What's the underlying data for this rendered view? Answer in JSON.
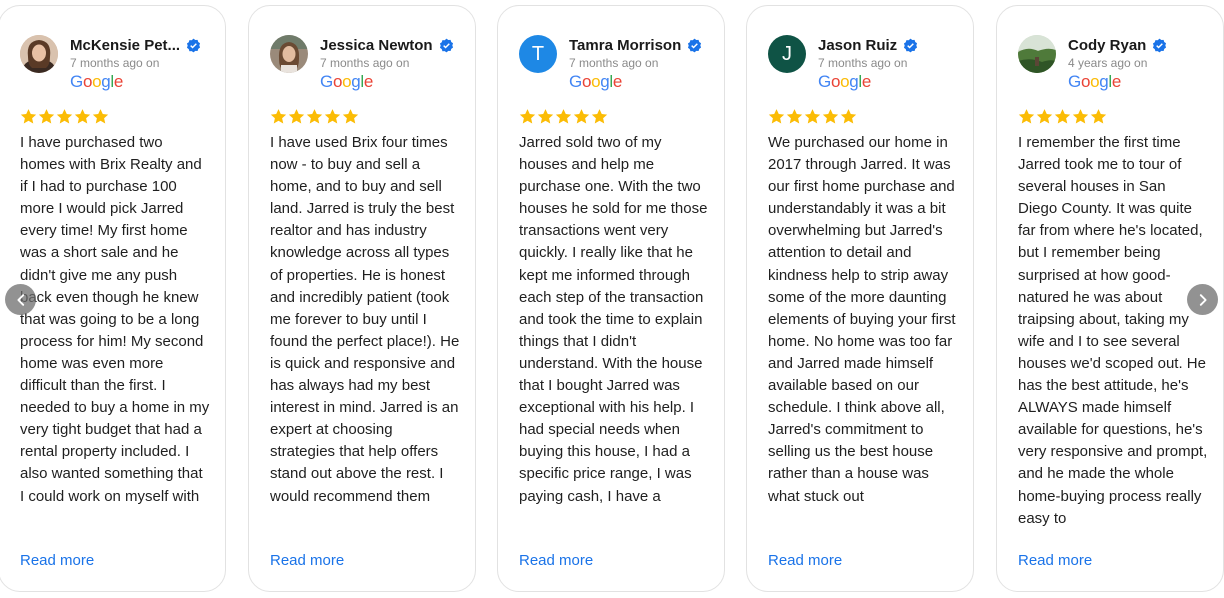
{
  "google_label": [
    "G",
    "o",
    "o",
    "g",
    "l",
    "e"
  ],
  "google_colors": [
    "#4285F4",
    "#EA4335",
    "#FBBC05",
    "#4285F4",
    "#34A853",
    "#EA4335"
  ],
  "star_color": "#FBBC05",
  "verified_color": "#1A73E8",
  "read_more_label": "Read more",
  "reviews": [
    {
      "name": "McKensie Pet...",
      "time": "7 months ago on",
      "avatar": "photo",
      "text": "I have purchased two homes with Brix Realty and if I had to purchase 100 more I would pick Jarred every time! My first home was a short sale and he didn't give me any push back even though he knew that was going to be a long process for him! My second home was even more difficult than the first. I needed to buy a home in my very tight budget that had a rental property included. I also wanted something that I could work on myself with"
    },
    {
      "name": "Jessica Newton",
      "time": "7 months ago on",
      "avatar": "photo",
      "text": "I have used Brix four times now - to buy and sell a home, and to buy and sell land. Jarred is truly the best realtor and has industry knowledge across all types of properties. He is honest and incredibly patient (took me forever to buy until I found the perfect place!). He is quick and responsive and has always had my best interest in mind. Jarred is an expert at choosing strategies that help offers stand out above the rest. I would recommend them"
    },
    {
      "name": "Tamra Morrison",
      "time": "7 months ago on",
      "avatar": "initial",
      "initial": "T",
      "avatar_color": "#1E88E5",
      "text": "Jarred sold two of my houses and help me purchase one. With the two houses he sold for me those transactions went very quickly. I really like that he kept me informed through each step of the transaction and took the time to explain things that I didn't understand. With the house that I bought Jarred was exceptional with his help. I had special needs when buying this house, I had a specific price range, I was paying cash, I have a"
    },
    {
      "name": "Jason Ruiz",
      "time": "7 months ago on",
      "avatar": "initial",
      "initial": "J",
      "avatar_color": "#0F5345",
      "text": "We purchased our home in 2017 through Jarred. It was our first home purchase and understandably it was a bit overwhelming but Jarred's attention to detail and kindness help to strip away some of the more daunting elements of buying your first home. No home was too far and Jarred made himself available based on our schedule. I think above all, Jarred's commitment to selling us the best house rather than a house was what stuck out"
    },
    {
      "name": "Cody Ryan",
      "time": "4 years ago on",
      "avatar": "photo",
      "text": "I remember the first time Jarred took me to tour of several houses in San Diego County. It was quite far from where he's located, but I remember being surprised at how good-natured he was about traipsing about, taking my wife and I to see several houses we'd scoped out. He has the best attitude, he's ALWAYS made himself available for questions, he's very responsive and prompt, and he made the whole home-buying process really easy to"
    }
  ]
}
